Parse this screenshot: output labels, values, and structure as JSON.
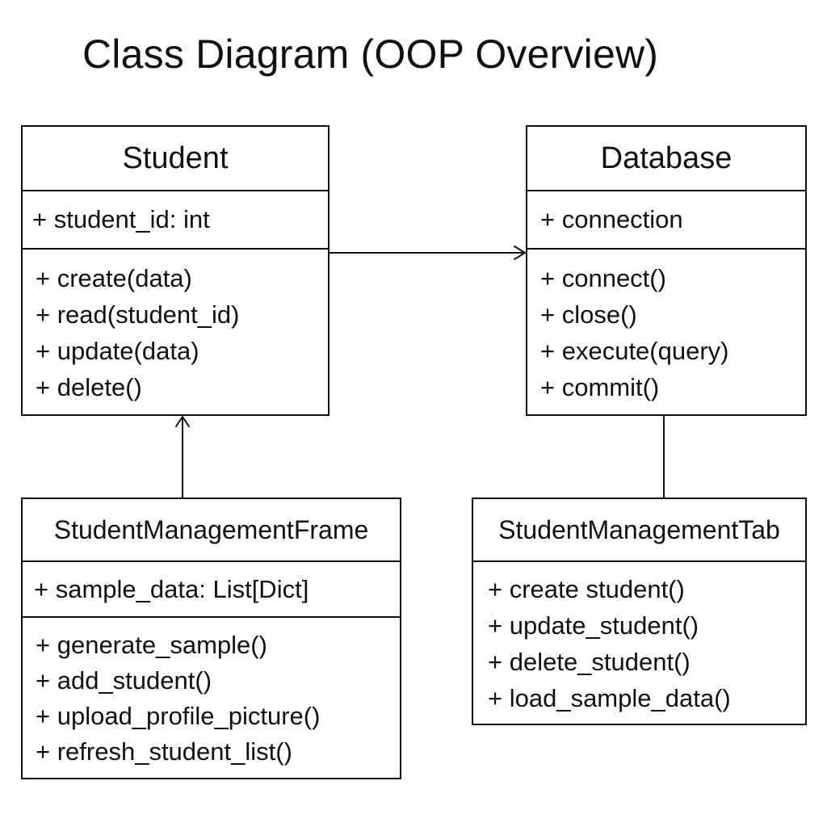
{
  "title": "Class Diagram (OOP Overview)",
  "classes": {
    "student": {
      "name": "Student",
      "attributes": [
        "+ student_id: int"
      ],
      "methods": [
        "+ create(data)",
        "+ read(student_id)",
        "+ update(data)",
        "+ delete()"
      ]
    },
    "database": {
      "name": "Database",
      "attributes": [
        "+ connection"
      ],
      "methods": [
        "+ connect()",
        "+ close()",
        "+ execute(query)",
        "+ commit()"
      ]
    },
    "frame": {
      "name": "StudentManagementFrame",
      "attributes": [
        "+ sample_data: List[Dict]"
      ],
      "methods": [
        "+ generate_sample()",
        "+ add_student()",
        "+ upload_profile_picture()",
        "+ refresh_student_list()"
      ]
    },
    "tab": {
      "name": "StudentManagementTab",
      "attributes": [],
      "methods": [
        "+ create student()",
        "+ update_student()",
        "+ delete_student()",
        "+ load_sample_data()"
      ]
    }
  },
  "relations": [
    {
      "from": "Student",
      "to": "Database",
      "kind": "association",
      "arrow": "open"
    },
    {
      "from": "StudentManagementFrame",
      "to": "Student",
      "kind": "association",
      "arrow": "open"
    },
    {
      "from": "Database",
      "to": "StudentManagementTab",
      "kind": "link",
      "arrow": "none"
    }
  ],
  "colors": {
    "line": "#111111",
    "background": "#ffffff"
  }
}
